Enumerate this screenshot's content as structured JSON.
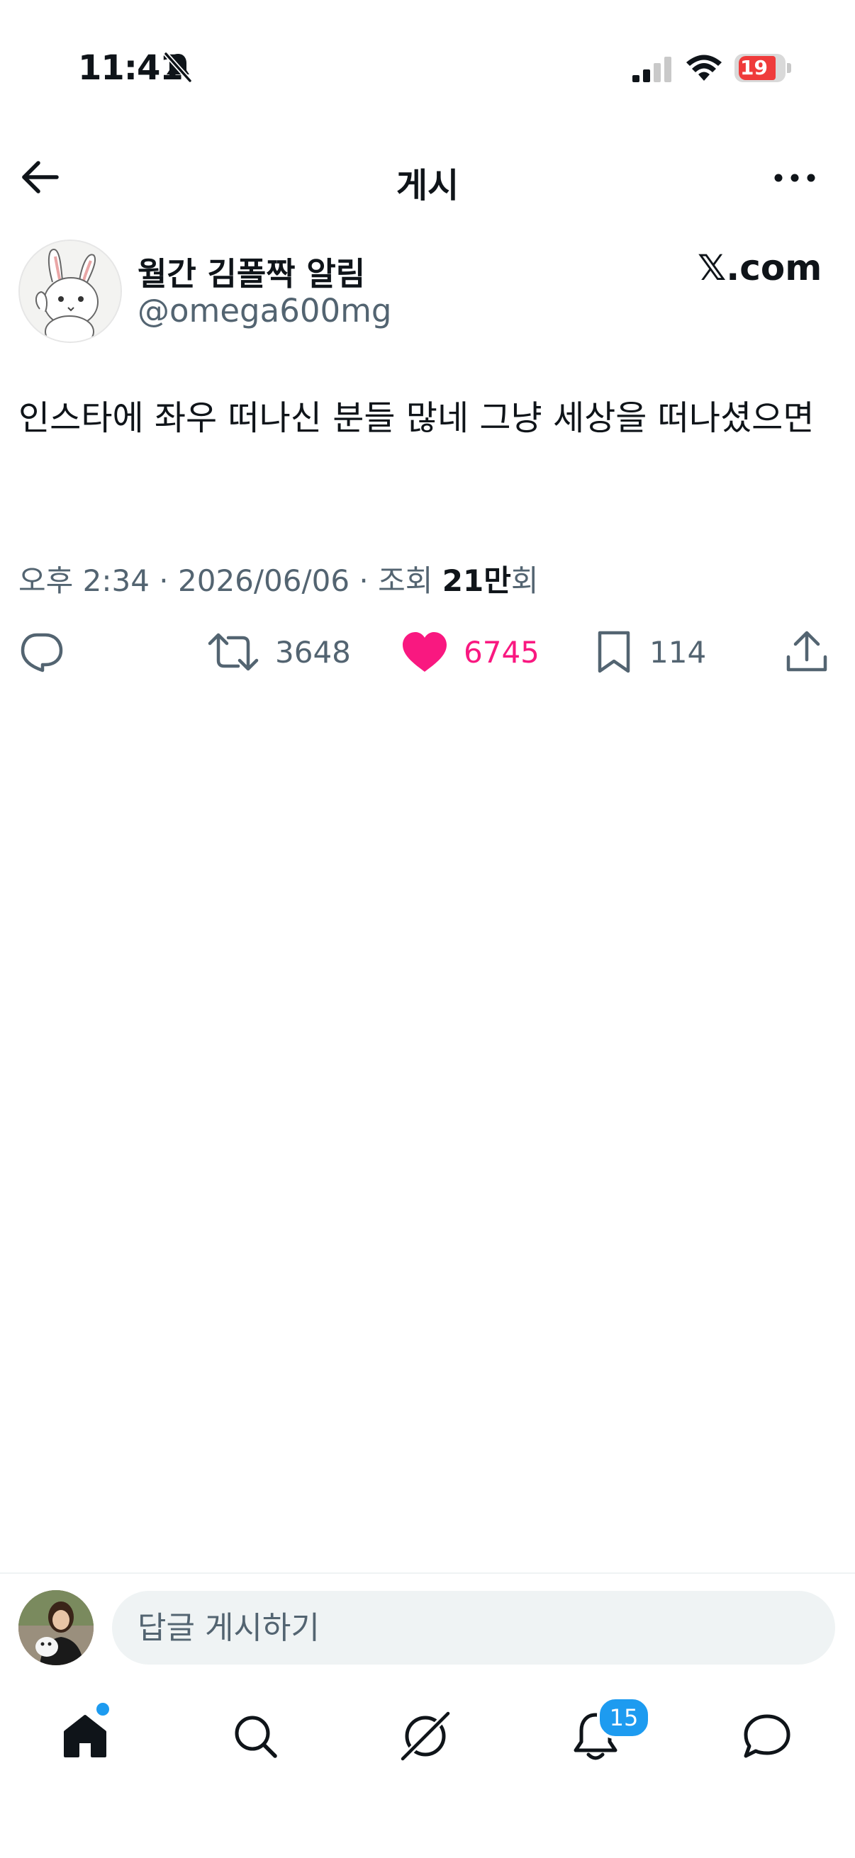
{
  "status_bar": {
    "time": "11:41",
    "battery": "19"
  },
  "header": {
    "title": "게시"
  },
  "author": {
    "name": "월간 김폴짝 알림",
    "handle": "@omega600mg",
    "badge": "𝕏.com"
  },
  "post": {
    "text": "인스타에 좌우 떠나신 분들 많네 그냥 세상을 떠나셨으면",
    "meta_prefix": "오후 2:34 · 2026/06/06 · 조회 ",
    "views": "21만",
    "views_suffix": "회"
  },
  "actions": {
    "retweets": "3648",
    "likes": "6745",
    "bookmarks": "114"
  },
  "reply": {
    "placeholder": "답글 게시하기"
  },
  "tabbar": {
    "notifications_badge": "15"
  },
  "colors": {
    "text": "#0f1419",
    "secondary": "#536471",
    "like": "#f91880",
    "accent": "#1d9bf0",
    "battery_low": "#ef3b3b"
  },
  "icons": {
    "status": [
      "bell-slash-icon",
      "cellular-signal-icon",
      "wifi-icon",
      "battery-icon"
    ],
    "header": [
      "back-arrow-icon",
      "more-icon"
    ],
    "actions": [
      "reply-icon",
      "retweet-icon",
      "heart-icon",
      "bookmark-icon",
      "share-icon"
    ],
    "tabbar": [
      "home-icon",
      "search-icon",
      "grok-icon",
      "notifications-icon",
      "messages-icon"
    ]
  }
}
